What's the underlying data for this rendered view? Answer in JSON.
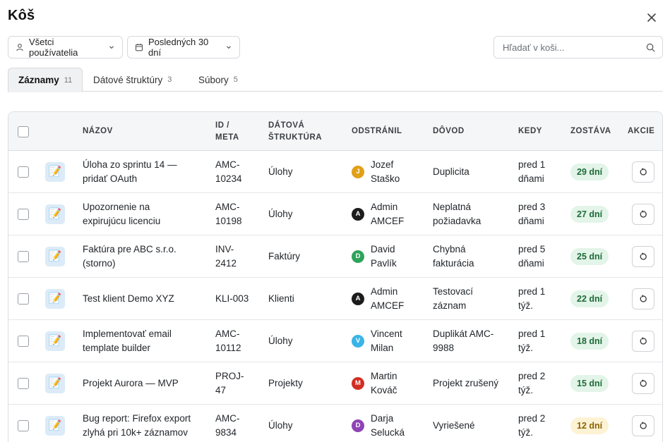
{
  "header": {
    "title": "Kôš"
  },
  "filters": {
    "users_label": "Všetci používatelia",
    "period_label": "Posledných 30 dní"
  },
  "search": {
    "placeholder": "Hľadať v koši..."
  },
  "tabs": [
    {
      "label": "Záznamy",
      "count": "11"
    },
    {
      "label": "Dátové štruktúry",
      "count": "3"
    },
    {
      "label": "Súbory",
      "count": "5"
    }
  ],
  "table": {
    "columns": {
      "name": "NÁZOV",
      "id": [
        "ID /",
        "META"
      ],
      "structure": [
        "DÁTOVÁ",
        "ŠTRUKTÚRA"
      ],
      "removed_by": "ODSTRÁNIL",
      "reason": "DÔVOD",
      "when": "KEDY",
      "remaining": "ZOSTÁVA",
      "actions": "AKCIE"
    },
    "rows": [
      {
        "icon": "memo-icon",
        "name": [
          "Úloha zo sprintu 14 —",
          "pridať OAuth"
        ],
        "id": [
          "AMC-",
          "10234"
        ],
        "structure": "Úlohy",
        "initial": "J",
        "avatar_color": "#e0a019",
        "user": [
          "Jozef",
          "Staško"
        ],
        "reason": [
          "Duplicita"
        ],
        "when": [
          "pred 1",
          "dňami"
        ],
        "remaining": "29 dní",
        "status": "green"
      },
      {
        "icon": "memo-icon",
        "name": [
          "Upozornenie na",
          "expirujúcu licenciu"
        ],
        "id": [
          "AMC-",
          "10198"
        ],
        "structure": "Úlohy",
        "initial": "A",
        "avatar_color": "#1c1c1c",
        "user": [
          "Admin",
          "AMCEF"
        ],
        "reason": [
          "Neplatná",
          "požiadavka"
        ],
        "when": [
          "pred 3",
          "dňami"
        ],
        "remaining": "27 dní",
        "status": "green"
      },
      {
        "icon": "memo-icon",
        "name": [
          "Faktúra pre ABC s.r.o.",
          "(storno)"
        ],
        "id": [
          "INV-",
          "2412"
        ],
        "structure": "Faktúry",
        "initial": "D",
        "avatar_color": "#2ea35a",
        "user": [
          "David",
          "Pavlík"
        ],
        "reason": [
          "Chybná",
          "fakturácia"
        ],
        "when": [
          "pred 5",
          "dňami"
        ],
        "remaining": "25 dní",
        "status": "green"
      },
      {
        "icon": "memo-icon",
        "name": [
          "Test klient Demo XYZ"
        ],
        "id": [
          "KLI-003"
        ],
        "structure": "Klienti",
        "initial": "A",
        "avatar_color": "#1c1c1c",
        "user": [
          "Admin",
          "AMCEF"
        ],
        "reason": [
          "Testovací",
          "záznam"
        ],
        "when": [
          "pred 1",
          "týž."
        ],
        "remaining": "22 dní",
        "status": "green"
      },
      {
        "icon": "memo-icon",
        "name": [
          "Implementovať email",
          "template builder"
        ],
        "id": [
          "AMC-",
          "10112"
        ],
        "structure": "Úlohy",
        "initial": "V",
        "avatar_color": "#3ab4e6",
        "user": [
          "Vincent",
          "Milan"
        ],
        "reason": [
          "Duplikát AMC-",
          "9988"
        ],
        "when": [
          "pred 1",
          "týž."
        ],
        "remaining": "18 dní",
        "status": "green"
      },
      {
        "icon": "memo-icon",
        "name": [
          "Projekt Aurora — MVP"
        ],
        "id": [
          "PROJ-",
          "47"
        ],
        "structure": "Projekty",
        "initial": "M",
        "avatar_color": "#d12e22",
        "user": [
          "Martin",
          "Kováč"
        ],
        "reason": [
          "Projekt zrušený"
        ],
        "when": [
          "pred 2",
          "týž."
        ],
        "remaining": "15 dní",
        "status": "green"
      },
      {
        "icon": "memo-icon",
        "name": [
          "Bug report: Firefox export",
          "zlyhá pri 10k+ záznamov"
        ],
        "id": [
          "AMC-",
          "9834"
        ],
        "structure": "Úlohy",
        "initial": "D",
        "avatar_color": "#8e44b5",
        "user": [
          "Darja",
          "Selucká"
        ],
        "reason": [
          "Vyriešené"
        ],
        "when": [
          "pred 2",
          "týž."
        ],
        "remaining": "12 dní",
        "status": "amber"
      }
    ]
  }
}
